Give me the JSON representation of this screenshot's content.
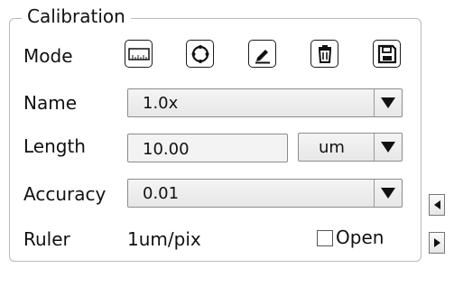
{
  "panel": {
    "title": "Calibration",
    "mode_label": "Mode",
    "name_label": "Name",
    "length_label": "Length",
    "accuracy_label": "Accuracy",
    "ruler_label": "Ruler",
    "ruler_value": "1um/pix",
    "open_label": "Open",
    "open_checked": false
  },
  "mode_buttons": [
    {
      "icon": "ruler-icon"
    },
    {
      "icon": "circle-icon"
    },
    {
      "icon": "pencil-icon"
    },
    {
      "icon": "trash-icon"
    },
    {
      "icon": "save-icon"
    }
  ],
  "fields": {
    "name_value": "1.0x",
    "length_value": "10.00",
    "unit_value": "um",
    "accuracy_value": "0.01"
  },
  "side_buttons": [
    {
      "icon": "arrow-left-icon"
    },
    {
      "icon": "arrow-right-icon"
    }
  ]
}
